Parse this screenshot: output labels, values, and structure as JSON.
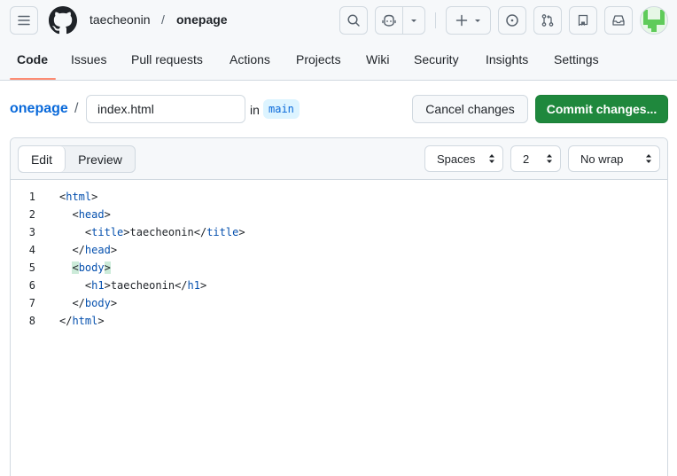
{
  "header": {
    "owner": "taecheonin",
    "separator": "/",
    "repo": "onepage"
  },
  "tabs": [
    {
      "label": "Code"
    },
    {
      "label": "Issues"
    },
    {
      "label": "Pull requests"
    },
    {
      "label": "Actions"
    },
    {
      "label": "Projects"
    },
    {
      "label": "Wiki"
    },
    {
      "label": "Security"
    },
    {
      "label": "Insights"
    },
    {
      "label": "Settings"
    }
  ],
  "path": {
    "repo": "onepage",
    "separator": "/",
    "filename": "index.html",
    "in_label": "in",
    "branch": "main"
  },
  "actions": {
    "cancel": "Cancel changes",
    "commit": "Commit changes..."
  },
  "editor": {
    "mode_edit": "Edit",
    "mode_preview": "Preview",
    "indent_mode": "Spaces",
    "indent_size": "2",
    "wrap_mode": "No wrap"
  },
  "code_lines": [
    {
      "n": "1",
      "indent": "",
      "parts": [
        [
          "p",
          "<"
        ],
        [
          "t",
          "html"
        ],
        [
          "p",
          ">"
        ]
      ]
    },
    {
      "n": "2",
      "indent": "  ",
      "parts": [
        [
          "p",
          "<"
        ],
        [
          "t",
          "head"
        ],
        [
          "p",
          ">"
        ]
      ]
    },
    {
      "n": "3",
      "indent": "    ",
      "parts": [
        [
          "p",
          "<"
        ],
        [
          "t",
          "title"
        ],
        [
          "p",
          ">taecheonin</"
        ],
        [
          "t",
          "title"
        ],
        [
          "p",
          ">"
        ]
      ]
    },
    {
      "n": "4",
      "indent": "  ",
      "parts": [
        [
          "p",
          "</"
        ],
        [
          "t",
          "head"
        ],
        [
          "p",
          ">"
        ]
      ]
    },
    {
      "n": "5",
      "indent": "  ",
      "parts": [
        [
          "h",
          "<"
        ],
        [
          "t",
          "body"
        ],
        [
          "h",
          ">"
        ]
      ]
    },
    {
      "n": "6",
      "indent": "    ",
      "parts": [
        [
          "p",
          "<"
        ],
        [
          "t",
          "h1"
        ],
        [
          "p",
          ">taecheonin</"
        ],
        [
          "t",
          "h1"
        ],
        [
          "p",
          ">"
        ]
      ]
    },
    {
      "n": "7",
      "indent": "  ",
      "parts": [
        [
          "p",
          "</"
        ],
        [
          "t",
          "body"
        ],
        [
          "p",
          ">"
        ]
      ]
    },
    {
      "n": "8",
      "indent": "",
      "parts": [
        [
          "p",
          "</"
        ],
        [
          "t",
          "html"
        ],
        [
          "p",
          ">"
        ]
      ]
    }
  ],
  "colors": {
    "accent": "#0969da",
    "commit_button": "#1f883d",
    "tab_underline": "#fd8c73",
    "tag": "#0550ae",
    "bracket_highlight": "#ccebd9"
  },
  "icons": [
    "menu-icon",
    "github-logo-icon",
    "search-icon",
    "copilot-icon",
    "chevron-down-icon",
    "plus-icon",
    "issue-icon",
    "pull-request-icon",
    "repo-icon",
    "inbox-icon"
  ]
}
